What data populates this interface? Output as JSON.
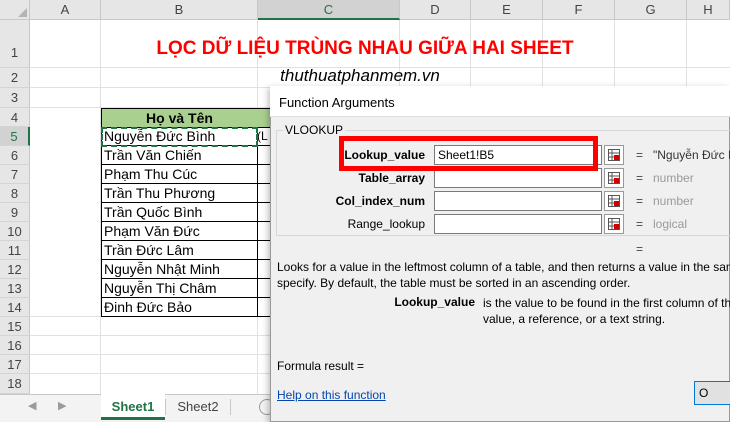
{
  "columns": [
    "A",
    "B",
    "C",
    "D",
    "E",
    "F",
    "G",
    "H"
  ],
  "rows": [
    "1",
    "2",
    "3",
    "4",
    "5",
    "6",
    "7",
    "8",
    "9",
    "10",
    "11",
    "12",
    "13",
    "14",
    "15",
    "16",
    "17",
    "18"
  ],
  "sheet": {
    "title": "LỌC DỮ LIỆU TRÙNG NHAU GIỮA HAI SHEET",
    "subtitle": "thuthuatphanmem.vn",
    "table_header": "Họ và Tên",
    "names": [
      "Nguyễn Đức Bình",
      "Trần Văn Chiến",
      "Phạm Thu Cúc",
      "Trần Thu Phương",
      "Trần Quốc Bình",
      "Phạm Văn Đức",
      "Trần Đức Lâm",
      "Nguyễn Nhật Minh",
      "Nguyễn Thị Châm",
      "Đinh Đức Bảo"
    ],
    "c5_partial": "(L"
  },
  "tabs": [
    "Sheet1",
    "Sheet2"
  ],
  "dialog": {
    "title": "Function Arguments",
    "function_name": "VLOOKUP",
    "args": [
      {
        "label": "Lookup_value",
        "value": "Sheet1!B5",
        "result": "\"Nguyễn Đức B"
      },
      {
        "label": "Table_array",
        "value": "",
        "result": "number"
      },
      {
        "label": "Col_index_num",
        "value": "",
        "result": "number"
      },
      {
        "label": "Range_lookup",
        "value": "",
        "result": "logical"
      }
    ],
    "equals": "=",
    "description_line1": "Looks for a value in the leftmost column of a table, and then returns a value in the same",
    "description_line2": "specify. By default, the table must be sorted in an ascending order.",
    "arg_desc_name": "Lookup_value",
    "arg_desc_line1": "is the value to be found in the first column of th",
    "arg_desc_line2": "value, a reference, or a text string.",
    "formula_result": "Formula result =",
    "help_link": "Help on this function",
    "ok_button": "O"
  },
  "colors": {
    "title_red": "#ff0000",
    "header_green": "#a9d08e",
    "excel_green": "#217346",
    "highlight_box": "#ff0000"
  }
}
